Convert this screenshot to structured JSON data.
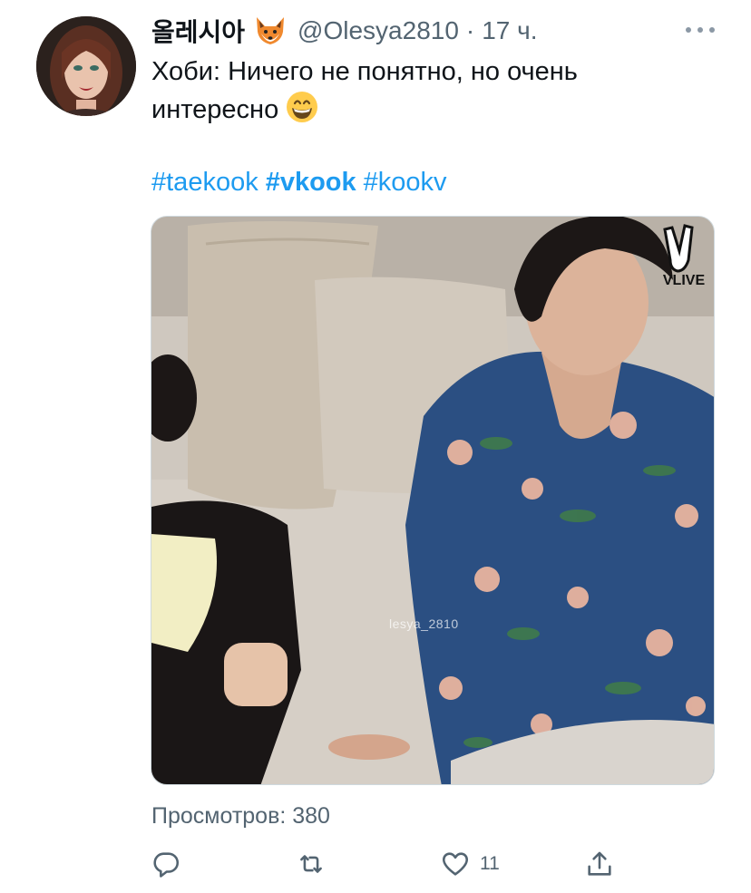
{
  "tweet": {
    "display_name": "올레시아",
    "name_emoji": "fox-face-icon",
    "handle": "@Olesya2810",
    "separator": "·",
    "time": "17 ч.",
    "text_line1": "Хоби: Ничего не понятно, но очень",
    "text_line2": "интересно",
    "text_emoji": "grinning-face-icon",
    "hashtags": [
      "#taekook",
      "#vkook",
      "#kookv"
    ],
    "views": "Просмотров: 380"
  },
  "media": {
    "badge_label": "VLIVE",
    "watermark": "lesya_2810"
  },
  "actions": {
    "reply_count": "",
    "retweet_count": "",
    "like_count": "11",
    "share_count": ""
  },
  "colors": {
    "link": "#1d9bf0",
    "secondary": "#536471",
    "text": "#0f1419"
  }
}
